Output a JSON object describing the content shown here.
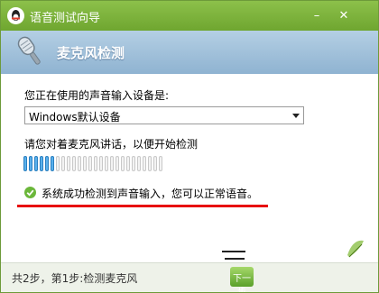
{
  "window": {
    "title": "语音测试向导",
    "minimize": "–",
    "close": "✕"
  },
  "header": {
    "title": "麦克风检测",
    "icon": "microphone-icon"
  },
  "device": {
    "label": "您正在使用的声音输入设备是:",
    "selected": "Windows默认设备"
  },
  "test": {
    "instruction": "请您对着麦克风讲话，以便开始检测",
    "level_active_segments": 6,
    "level_total_segments": 26,
    "result": "系统成功检测到声音输入，您可以正常语音。",
    "result_icon": "check-circle-icon"
  },
  "footer": {
    "step_text": "共2步，第1步:检测麦克风",
    "next_label": "下一步"
  },
  "colors": {
    "titlebar": "#7db53c",
    "header": "#9dbfdc",
    "meter_active": "#58b0ec",
    "underline": "#e81010"
  }
}
